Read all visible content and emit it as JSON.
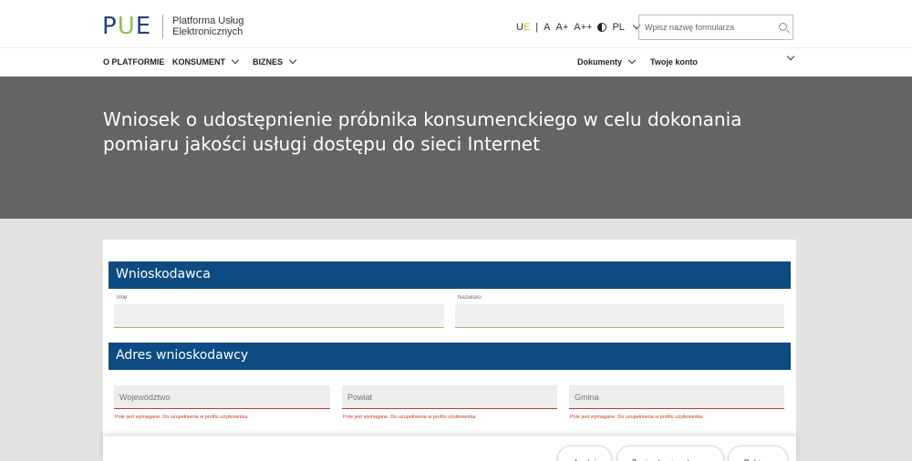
{
  "header": {
    "logo": {
      "p": "P",
      "u": "U",
      "e": "E",
      "line1": "Platforma Usług",
      "line2": "Elektronicznych"
    },
    "a11y": {
      "ue_u": "U",
      "ue_e": "E",
      "sep": "|",
      "font_a": "A",
      "font_a_plus": "A+",
      "font_a_plus_plus": "A++",
      "lang": "PL"
    },
    "search": {
      "placeholder": "Wpisz nazwę formularza"
    },
    "nav": {
      "platform": "O PLATFORMIE",
      "consumer": "KONSUMENT",
      "business": "BIZNES",
      "documents": "Dokumenty",
      "account": "Twoje konto"
    }
  },
  "banner": {
    "title": "Wniosek o udostępnienie próbnika konsumenckiego w celu dokonania pomiaru jakości usługi dostępu do sieci Internet"
  },
  "form": {
    "section1": {
      "title": "Wnioskodawca",
      "first_name_label": "Imię",
      "last_name_label": "Nazwisko"
    },
    "section2": {
      "title": "Adres wnioskodawcy",
      "voivodeship": {
        "placeholder": "Województwo",
        "error": "Pole jest wymagane. Do uzupełnienia w profilu użytkownika."
      },
      "county": {
        "placeholder": "Powiat",
        "error": "Pole jest wymagane. Do uzupełnienia w profilu użytkownika."
      },
      "commune": {
        "placeholder": "Gmina",
        "error": "Pole jest wymagane. Do uzupełnienia w profilu użytkownika."
      }
    }
  },
  "actions": {
    "cancel": "Anuluj",
    "save_draft": "Zapisz kopię roboczą",
    "download": "Pobierz"
  },
  "colors": {
    "brand_blue": "#24427b",
    "brand_green": "#8ec04e",
    "section_blue": "#0d4b82",
    "banner_gray": "#646464",
    "error_red": "#c0392b"
  }
}
